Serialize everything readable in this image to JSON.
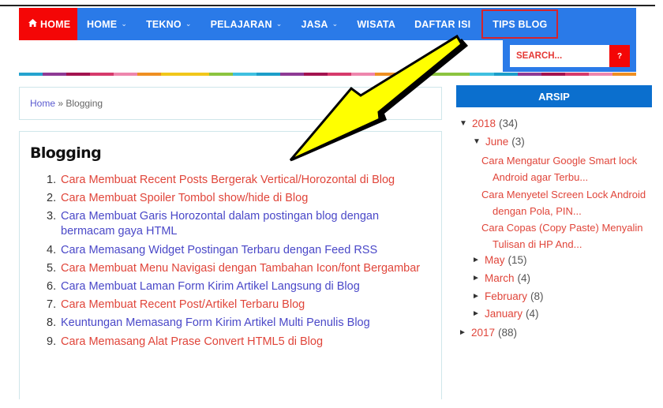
{
  "nav": {
    "home_icon": "home-icon",
    "items": [
      {
        "label": "HOME",
        "active": true,
        "icon": "home-icon",
        "dropdown": false
      },
      {
        "label": "HOME",
        "dropdown": true
      },
      {
        "label": "TEKNO",
        "dropdown": true
      },
      {
        "label": "PELAJARAN",
        "dropdown": true
      },
      {
        "label": "JASA",
        "dropdown": true
      },
      {
        "label": "WISATA",
        "dropdown": false
      },
      {
        "label": "DAFTAR ISI",
        "dropdown": false
      },
      {
        "label": "TIPS BLOG",
        "dropdown": false,
        "highlighted": true
      }
    ],
    "chevron": "⌄"
  },
  "search": {
    "placeholder": "SEARCH...",
    "button_label": "?"
  },
  "stripe_colors": [
    "#25a3cf",
    "#8e3a94",
    "#a3134f",
    "#d63a6b",
    "#ee86ad",
    "#ef8f22",
    "#f1c71a",
    "#f1c71a",
    "#8cc43f",
    "#3fc0e0",
    "#1c9ec9",
    "#8e3a94",
    "#a3134f",
    "#d63a6b",
    "#ee86ad",
    "#ef8f22",
    "#f1c71a",
    "#8cc43f",
    "#8cc43f",
    "#3fc0e0",
    "#1c9ec9",
    "#8e3a94",
    "#a3134f",
    "#d63a6b",
    "#ee86ad",
    "#ef8f22"
  ],
  "breadcrumb": {
    "home": "Home",
    "separator": " » ",
    "current": "Blogging"
  },
  "content": {
    "title": "Blogging",
    "posts": [
      {
        "num": "1.",
        "title": "Cara Membuat Recent Posts Bergerak Vertical/Horozontal di Blog",
        "visited": false
      },
      {
        "num": "2.",
        "title": "Cara Membuat Spoiler Tombol show/hide di Blog",
        "visited": false
      },
      {
        "num": "3.",
        "title": "Cara Membuat Garis Horozontal dalam postingan blog dengan bermacam gaya HTML",
        "visited": true
      },
      {
        "num": "4.",
        "title": "Cara Memasang Widget Postingan Terbaru dengan Feed RSS",
        "visited": true
      },
      {
        "num": "5.",
        "title": "Cara Membuat Menu Navigasi dengan Tambahan Icon/font Bergambar",
        "visited": false
      },
      {
        "num": "6.",
        "title": "Cara Membuat Laman Form Kirim Artikel Langsung di Blog",
        "visited": true
      },
      {
        "num": "7.",
        "title": "Cara Membuat Recent Post/Artikel Terbaru Blog",
        "visited": false
      },
      {
        "num": "8.",
        "title": "Keuntungan Memasang Form Kirim Artikel Multi Penulis Blog",
        "visited": true
      },
      {
        "num": "9.",
        "title": "Cara Memasang Alat Prase Convert HTML5 di Blog",
        "visited": false
      }
    ]
  },
  "sidebar": {
    "archive_title": "ARSIP",
    "expanded_icon": "▼",
    "collapsed_icon": "►",
    "years": [
      {
        "year": "2018",
        "count": "(34)",
        "expanded": true,
        "months": [
          {
            "month": "June",
            "count": "(3)",
            "expanded": true,
            "posts": [
              {
                "line1": "Cara Mengatur Google Smart lock",
                "line2": "Android agar Terbu..."
              },
              {
                "line1": "Cara Menyetel Screen Lock Android",
                "line2": "dengan Pola, PIN..."
              },
              {
                "line1": "Cara Copas (Copy Paste) Menyalin",
                "line2": "Tulisan di HP And..."
              }
            ]
          },
          {
            "month": "May",
            "count": "(15)",
            "expanded": false
          },
          {
            "month": "March",
            "count": "(4)",
            "expanded": false
          },
          {
            "month": "February",
            "count": "(8)",
            "expanded": false
          },
          {
            "month": "January",
            "count": "(4)",
            "expanded": false
          }
        ]
      },
      {
        "year": "2017",
        "count": "(88)",
        "expanded": false
      }
    ]
  },
  "annotation": {
    "type": "arrow",
    "fill": "#ffff00",
    "outline": "#000000",
    "highlight_box_color": "#d6232c"
  }
}
